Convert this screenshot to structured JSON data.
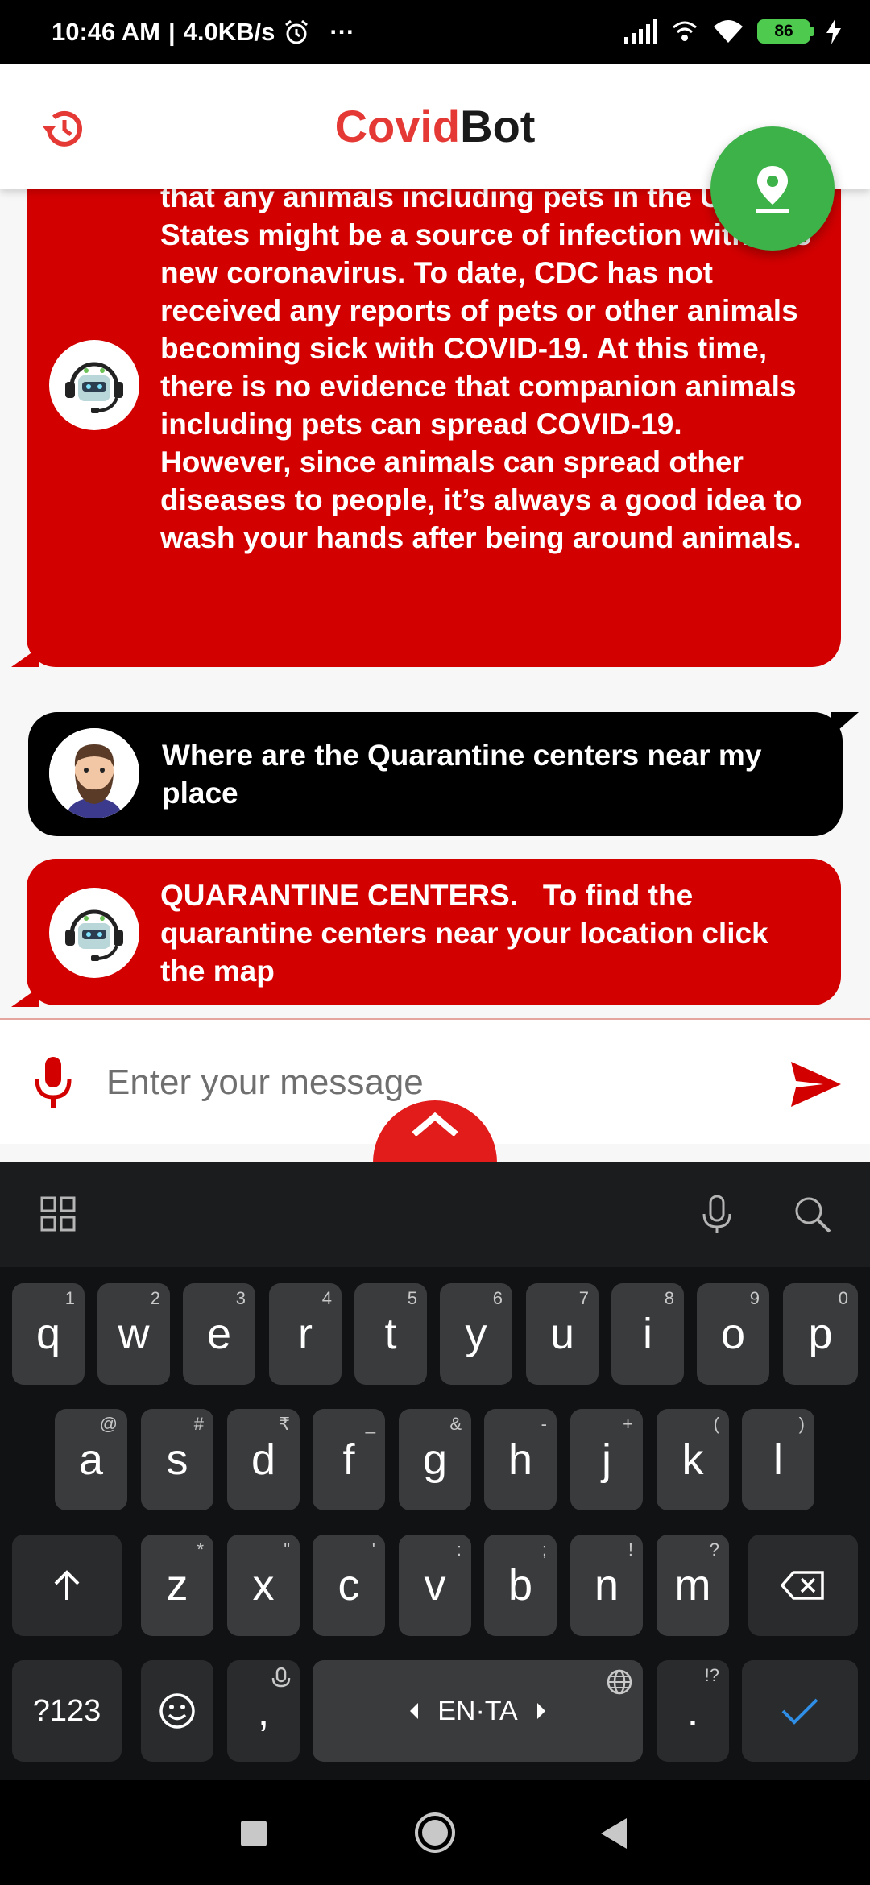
{
  "status_bar": {
    "time": "10:46 AM",
    "speed": "4.0KB/s",
    "more": "···",
    "battery": "86"
  },
  "header": {
    "title_part1": "Covid",
    "title_part2": "Bot"
  },
  "messages": [
    {
      "sender": "bot",
      "text": "person-to-person. There is no reason to think that any animals including pets in the United States might be a source of infection with this new coronavirus. To date, CDC has not received any reports of pets or other animals becoming sick with COVID-19. At this time, there is no evidence that companion animals including pets can spread COVID-19. However, since animals can spread other diseases to people, it’s always a good idea to wash your hands after being around animals."
    },
    {
      "sender": "user",
      "text": "Where are the Quarantine centers near my place"
    },
    {
      "sender": "bot",
      "text": "QUARANTINE CENTERS.   To find the quarantine centers near your location click the map"
    }
  ],
  "composer": {
    "placeholder": "Enter your message"
  },
  "keyboard": {
    "row1": [
      {
        "key": "q",
        "hint": "1"
      },
      {
        "key": "w",
        "hint": "2"
      },
      {
        "key": "e",
        "hint": "3"
      },
      {
        "key": "r",
        "hint": "4"
      },
      {
        "key": "t",
        "hint": "5"
      },
      {
        "key": "y",
        "hint": "6"
      },
      {
        "key": "u",
        "hint": "7"
      },
      {
        "key": "i",
        "hint": "8"
      },
      {
        "key": "o",
        "hint": "9"
      },
      {
        "key": "p",
        "hint": "0"
      }
    ],
    "row2": [
      {
        "key": "a",
        "hint": "@"
      },
      {
        "key": "s",
        "hint": "#"
      },
      {
        "key": "d",
        "hint": "₹"
      },
      {
        "key": "f",
        "hint": "_"
      },
      {
        "key": "g",
        "hint": "&"
      },
      {
        "key": "h",
        "hint": "-"
      },
      {
        "key": "j",
        "hint": "+"
      },
      {
        "key": "k",
        "hint": "("
      },
      {
        "key": "l",
        "hint": ")"
      }
    ],
    "row3": [
      {
        "key": "z",
        "hint": "*"
      },
      {
        "key": "x",
        "hint": "\""
      },
      {
        "key": "c",
        "hint": "'"
      },
      {
        "key": "v",
        "hint": ":"
      },
      {
        "key": "b",
        "hint": ";"
      },
      {
        "key": "n",
        "hint": "!"
      },
      {
        "key": "m",
        "hint": "?"
      }
    ],
    "symbols_label": "?123",
    "comma": ",",
    "period": ".",
    "period_hint": "!?",
    "language": "EN·TA"
  }
}
